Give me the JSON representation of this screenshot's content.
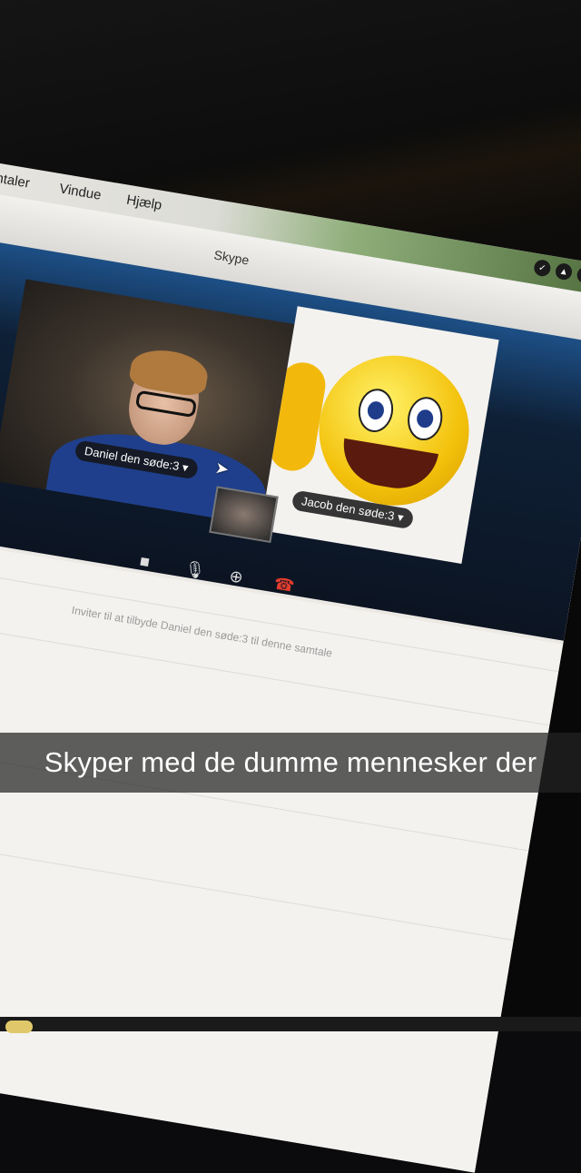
{
  "menubar": {
    "items": [
      "mtaler",
      "Vindue",
      "Hjælp"
    ]
  },
  "window": {
    "title": "Skype"
  },
  "call": {
    "participant_left": "Daniel den søde:3",
    "participant_right": "Jacob den søde:3"
  },
  "chat": {
    "line": "Inviter til at tilbyde Daniel den søde:3 til denne samtale"
  },
  "caption": {
    "text": "Skyper med de dumme mennesker der"
  },
  "colors": {
    "hangup": "#e23d2d",
    "call_bg_top": "#1d4f86",
    "caption_bg": "#232323"
  },
  "icons": {
    "video": "video-camera-icon",
    "mic": "microphone-icon",
    "add": "add-participant-icon",
    "hangup": "hang-up-icon"
  }
}
